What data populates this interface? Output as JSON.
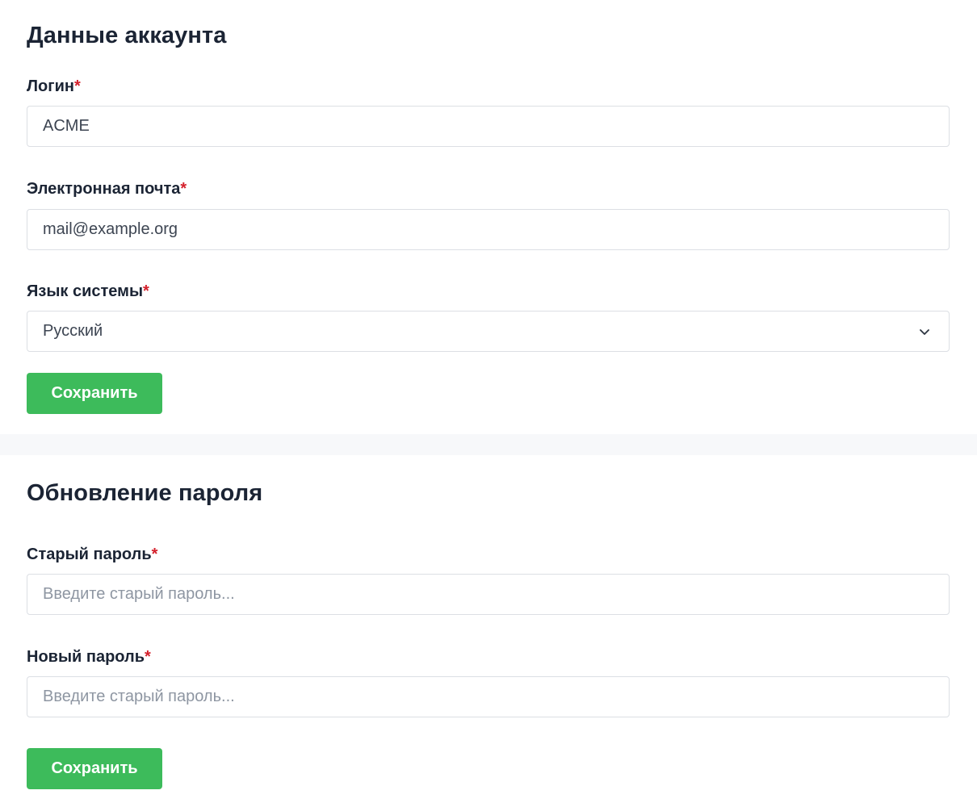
{
  "account": {
    "heading": "Данные аккаунта",
    "login": {
      "label": "Логин",
      "required_mark": "*",
      "value": "ACME"
    },
    "email": {
      "label": "Электронная почта",
      "required_mark": "*",
      "value": "mail@example.org"
    },
    "language": {
      "label": "Язык системы",
      "required_mark": "*",
      "selected": "Русский",
      "icon": "chevron-down-icon"
    },
    "save_label": "Сохранить"
  },
  "password": {
    "heading": "Обновление пароля",
    "old": {
      "label": "Старый пароль",
      "required_mark": "*",
      "placeholder": "Введите старый пароль..."
    },
    "new": {
      "label": "Новый пароль",
      "required_mark": "*",
      "placeholder": "Введите старый пароль..."
    },
    "save_label": "Сохранить"
  },
  "colors": {
    "accent": "#3dbb5b",
    "required": "#d4202b",
    "text": "#1b2434",
    "divider": "#f7f8fa"
  }
}
